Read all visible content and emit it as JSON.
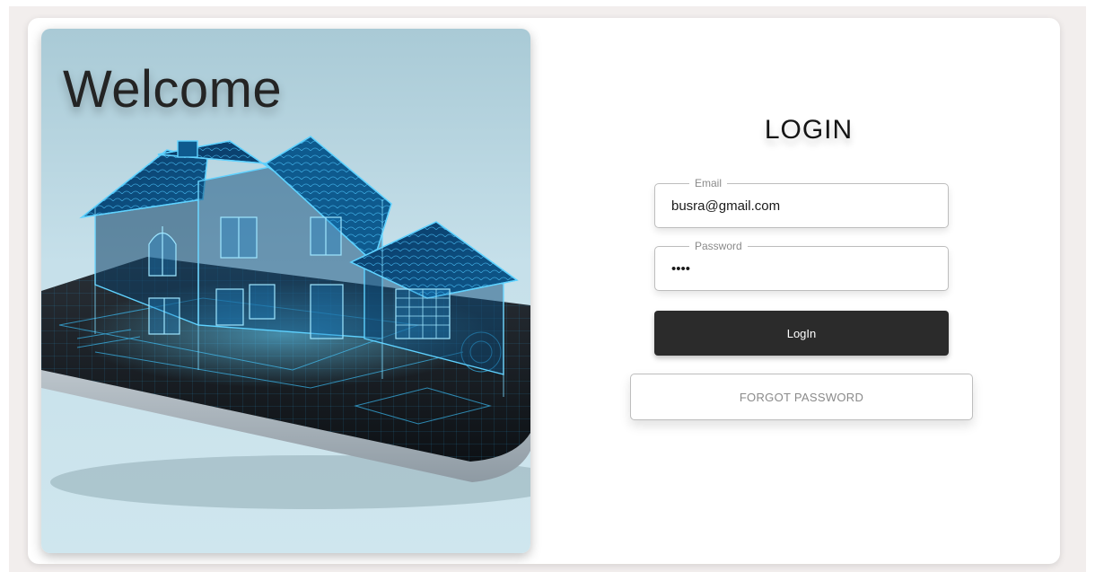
{
  "hero": {
    "welcome_text": "Welcome",
    "image_icon": "holographic-house-on-tablet"
  },
  "login": {
    "title": "LOGIN",
    "email": {
      "label": "Email",
      "value": "busra@gmail.com"
    },
    "password": {
      "label": "Password",
      "value": "••••"
    },
    "login_button_label": "LogIn",
    "forgot_password_label": "FORGOT PASSWORD"
  },
  "colors": {
    "page_background": "#f2eeed",
    "card_background": "#ffffff",
    "primary_button": "#2b2b2b",
    "hologram_blue": "#1fb4ff"
  }
}
